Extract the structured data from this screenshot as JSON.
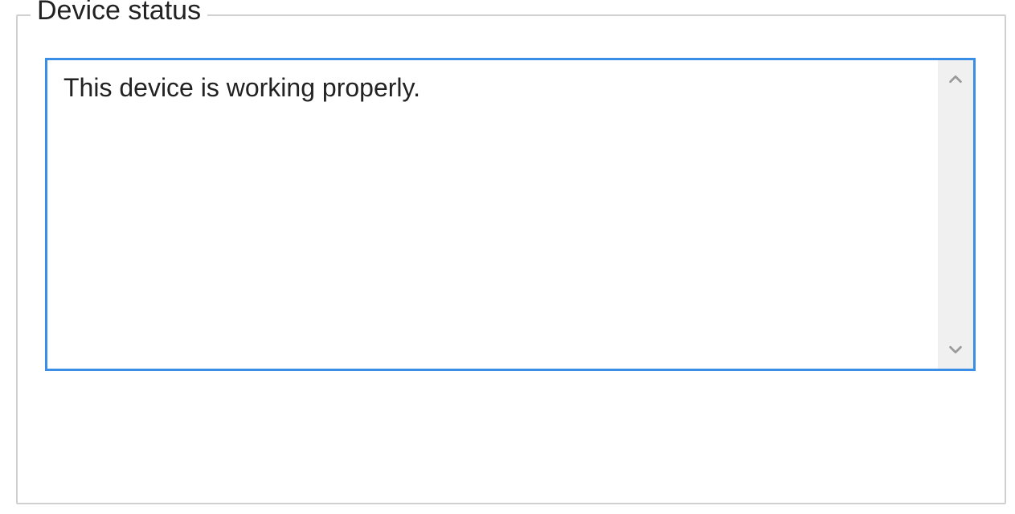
{
  "group": {
    "legend": "Device status",
    "status_text": "This device is working properly."
  }
}
